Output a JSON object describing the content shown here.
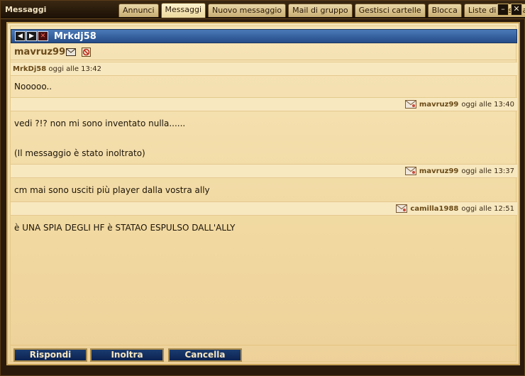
{
  "window": {
    "title": "Messaggi"
  },
  "tabs": [
    {
      "label": "Annunci"
    },
    {
      "label": "Messaggi",
      "active": true
    },
    {
      "label": "Nuovo messaggio"
    },
    {
      "label": "Mail di gruppo"
    },
    {
      "label": "Gestisci cartelle"
    },
    {
      "label": "Blocca"
    },
    {
      "label": "Liste di destinatari"
    }
  ],
  "controls": {
    "minimize": "–",
    "close": "✕"
  },
  "header": {
    "title": "Mrkdj58",
    "prev": "◀",
    "next": "▶",
    "delete": "✕"
  },
  "contact": {
    "name": "mavruz99"
  },
  "messages": [
    {
      "author": "MrkDj58",
      "time": "oggi alle 13:42",
      "lines": [
        "Nooooo.."
      ]
    },
    {
      "author": "mavruz99",
      "time": "oggi alle 13:40",
      "lines": [
        "vedi ?!? non mi sono inventato nulla......",
        "",
        "(Il messaggio è stato inoltrato)"
      ]
    },
    {
      "author": "mavruz99",
      "time": "oggi alle 13:37",
      "lines": [
        "cm mai sono usciti più player dalla vostra ally"
      ]
    },
    {
      "author": "camilla1988",
      "time": "oggi alle 12:51",
      "lines": [
        "è UNA SPIA DEGLI HF è STATAO ESPULSO DALL'ALLY"
      ]
    }
  ],
  "buttons": {
    "reply": "Rispondi",
    "forward": "Inoltra",
    "delete": "Cancella"
  },
  "colors": {
    "header_blue": "#2d5796",
    "parchment": "#f2dca6",
    "button_blue": "#13306a"
  }
}
